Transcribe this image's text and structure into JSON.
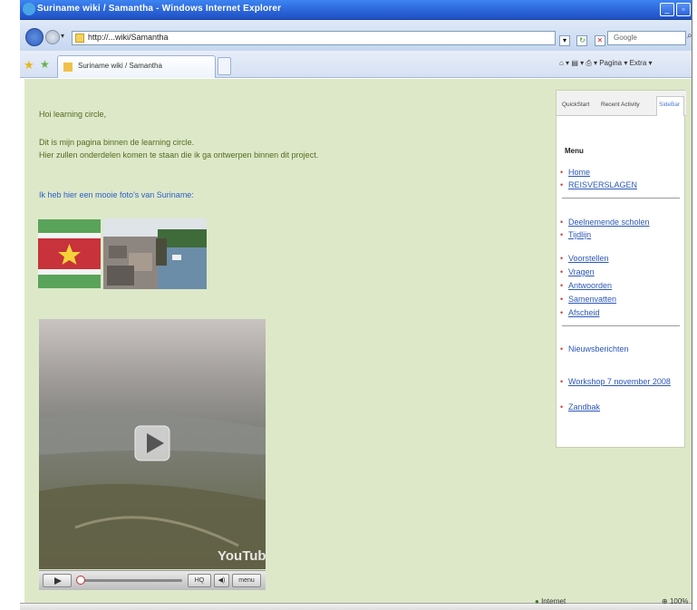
{
  "window": {
    "title": "Suriname wiki / Samantha - Windows Internet Explorer"
  },
  "address": {
    "url": "http://...wiki/Samantha",
    "search_placeholder": "Google"
  },
  "tabs": [
    {
      "label": "Suriname wiki / Samantha"
    }
  ],
  "toolbar": {
    "commands": "Pagina ▾ Extra ▾"
  },
  "content": {
    "greeting": "Hoi learning circle,",
    "intro_lines": [
      "Dit is mijn pagina binnen de learning circle.",
      "Hier zullen onderdelen komen te staan die ik ga ontwerpen binnen dit project."
    ],
    "photos_link": "Ik heb hier een mooie foto's van Suriname:",
    "video": {
      "brand": "YouTube",
      "btn_quality": "HQ",
      "btn_volume": "◀)",
      "btn_menu": "menu"
    }
  },
  "sidebar": {
    "tabs": [
      "QuickStart",
      "Recent Activity",
      "SideBar"
    ],
    "menu_title": "Menu",
    "items": [
      {
        "label": "Home"
      },
      {
        "label": "REISVERSLAGEN"
      },
      {
        "label": "Deelnemende scholen"
      },
      {
        "label": "Tijdlijn"
      },
      {
        "label": "Voorstellen"
      },
      {
        "label": "Vragen"
      },
      {
        "label": "Antwoorden"
      },
      {
        "label": "Samenvatten"
      },
      {
        "label": "Afscheid"
      },
      {
        "label": "Nieuwsberichten"
      },
      {
        "label": "Workshop 7 november 2008"
      },
      {
        "label": "Zandbak"
      }
    ]
  },
  "status": {
    "zone": "Internet",
    "zoom": "100%"
  },
  "colors": {
    "page_bg": "#dde8c9",
    "link": "#2d5ec8",
    "text": "#546b1d",
    "titlebar": "#2a63d6"
  }
}
